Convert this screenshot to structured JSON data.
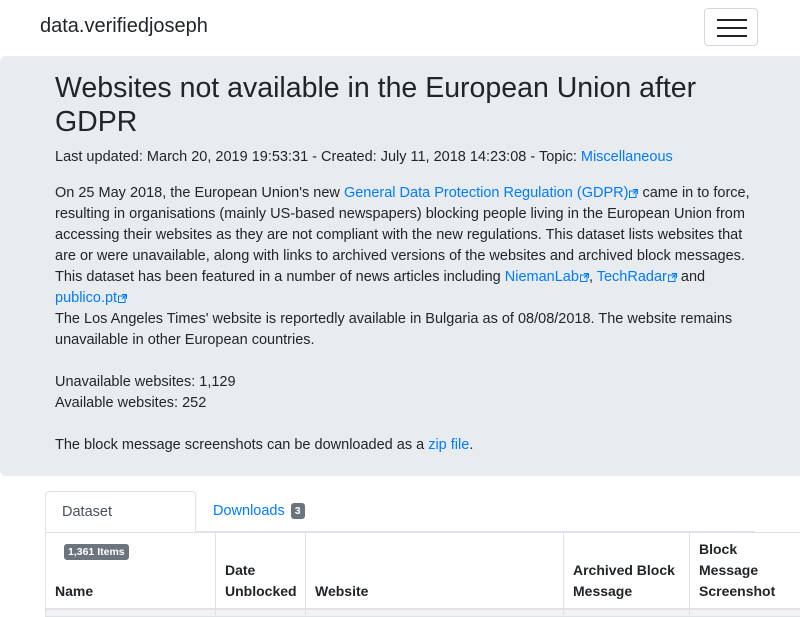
{
  "navbar": {
    "brand": "data.verifiedjoseph",
    "toggler_icon": "hamburger-menu-icon"
  },
  "header": {
    "title": "Websites not available in the European Union after GDPR",
    "last_updated_label": "Last updated: ",
    "last_updated": "March 20, 2019 19:53:31",
    "created_label": " - Created: ",
    "created": "July 11, 2018 14:23:08",
    "topic_label": " - Topic: ",
    "topic": "Miscellaneous"
  },
  "intro": {
    "p1_a": "On 25 May 2018, the European Union's new ",
    "gdpr_link": "General Data Protection Regulation (GDPR)",
    "p1_b": " came in to force, resulting in organisations (mainly US-based newspapers) blocking people living in the European Union from accessing their websites as they are not compliant with the new regulations. This dataset lists websites that are or were unavailable, along with links to archived versions of the websites and archived block messages. This dataset has been featured in a number of news articles including ",
    "link_niemanlab": "NiemanLab",
    "sep1": ", ",
    "link_techradar": "TechRadar",
    "sep2": " and ",
    "link_publico": "publico.pt",
    "p2": "The Los Angeles Times' website is reportedly available in Bulgaria as of 08/08/2018. The website remains unavailable in other European countries.",
    "unavailable": "Unavailable websites: 1,129",
    "available": "Available websites: 252",
    "p4_a": "The block message screenshots can be downloaded as a ",
    "zip_link": "zip file",
    "p4_b": "."
  },
  "tabs": [
    {
      "label": "Dataset",
      "badge": "1,361 Items"
    },
    {
      "label": "Downloads",
      "badge": "3"
    }
  ],
  "table": {
    "headers": [
      "Name",
      "Date Unblocked",
      "Website",
      "Archived Block Message",
      "Block Message Screenshot"
    ]
  }
}
